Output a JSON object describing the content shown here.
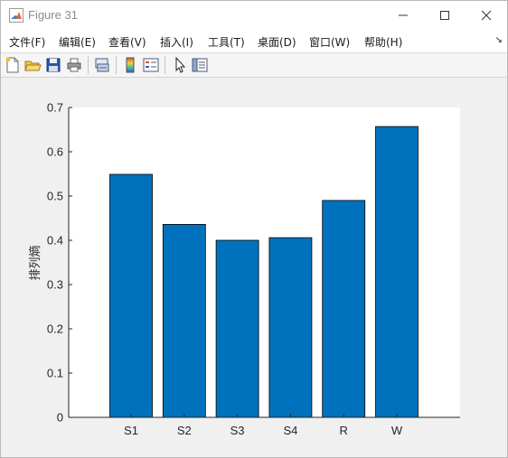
{
  "window": {
    "title": "Figure 31"
  },
  "menu": {
    "items": [
      "文件(F)",
      "编辑(E)",
      "查看(V)",
      "插入(I)",
      "工具(T)",
      "桌面(D)",
      "窗口(W)",
      "帮助(H)"
    ],
    "overflow_icon": "dock-arrow-icon"
  },
  "toolbar": {
    "tools": [
      "new-figure-icon",
      "open-file-icon",
      "save-icon",
      "print-icon",
      "link-plot-icon",
      "colorbar-icon",
      "legend-icon",
      "pointer-icon",
      "property-inspector-icon"
    ]
  },
  "chart_data": {
    "type": "bar",
    "categories": [
      "S1",
      "S2",
      "S3",
      "S4",
      "R",
      "W"
    ],
    "values": [
      0.549,
      0.436,
      0.4,
      0.406,
      0.49,
      0.657
    ],
    "ylabel": "排列熵",
    "xlabel": "",
    "title": "",
    "ylim": [
      0,
      0.7
    ],
    "yticks": [
      "0",
      "0.1",
      "0.2",
      "0.3",
      "0.4",
      "0.5",
      "0.6",
      "0.7"
    ],
    "bar_color": "#0072bd",
    "grid": false
  }
}
